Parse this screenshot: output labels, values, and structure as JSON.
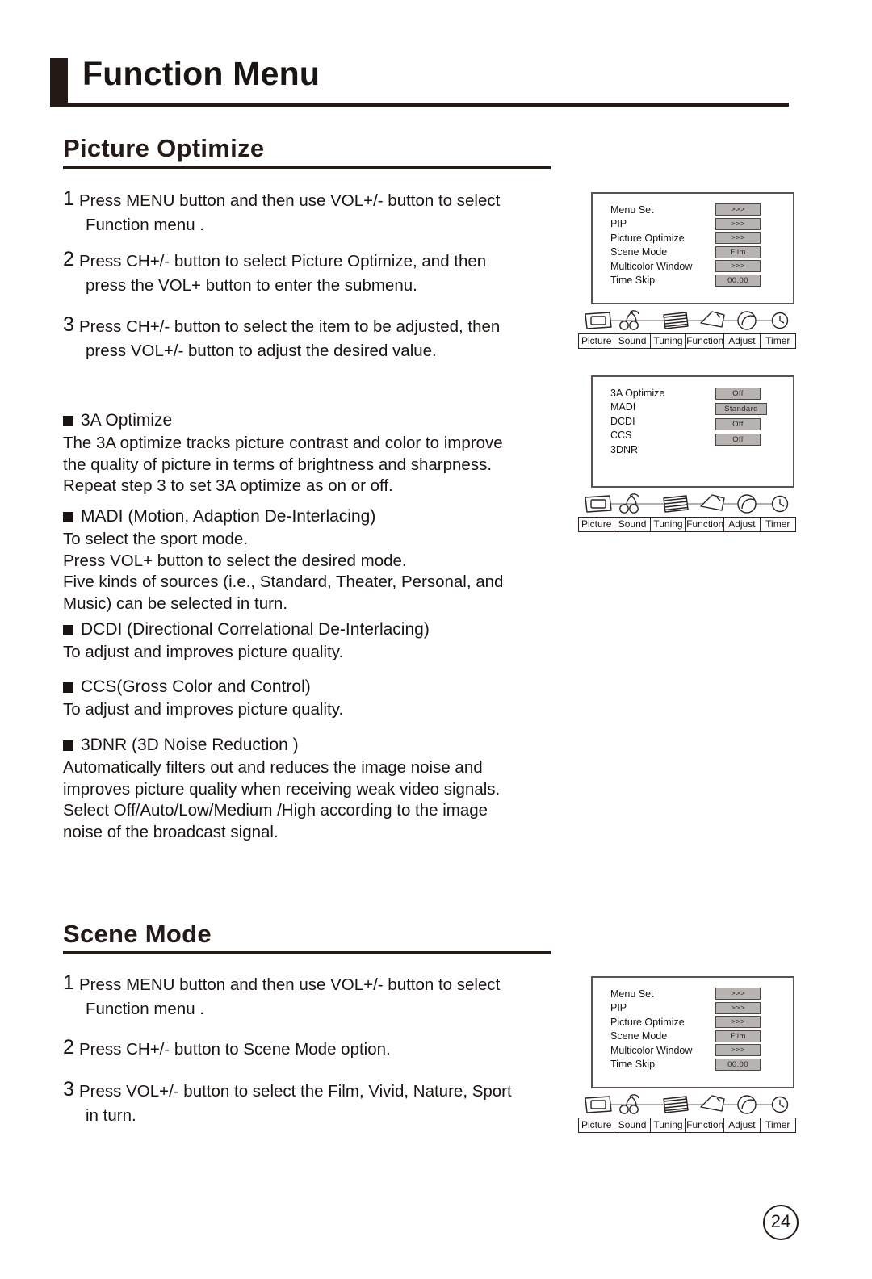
{
  "header": {
    "title": "Function Menu"
  },
  "sections": [
    {
      "heading": "Picture Optimize",
      "steps": [
        {
          "num": "1",
          "lines": [
            "Press MENU button and then use VOL+/- button to select",
            "Function  menu ."
          ]
        },
        {
          "num": "2",
          "lines": [
            "Press CH+/- button to select Picture Optimize, and then",
            "press the VOL+ button to enter the submenu."
          ]
        },
        {
          "num": "3",
          "lines": [
            "Press CH+/- button to select the item to be adjusted, then",
            "press VOL+/- button to adjust the desired value."
          ]
        }
      ]
    },
    {
      "heading": "Scene Mode",
      "steps": [
        {
          "num": "1",
          "lines": [
            "Press MENU button and then use VOL+/- button to select",
            "Function  menu ."
          ]
        },
        {
          "num": "2",
          "lines": [
            "Press CH+/- button to  Scene Mode option."
          ]
        },
        {
          "num": "3",
          "lines": [
            "Press VOL+/- button to select the Film, Vivid, Nature, Sport",
            "in turn."
          ]
        }
      ]
    }
  ],
  "feature_blocks": [
    {
      "title": "3A Optimize",
      "lines": [
        "The 3A optimize tracks picture contrast and color to improve",
        "the quality of picture in terms of brightness and sharpness.",
        "Repeat step 3 to set  3A optimize  as on or off."
      ]
    },
    {
      "title": "MADI (Motion, Adaption De-Interlacing)",
      "lines": [
        "To select the sport mode.",
        "Press VOL+ button to select the desired mode.",
        "Five kinds of sources (i.e., Standard, Theater, Personal, and",
        "Music) can be selected in turn."
      ]
    },
    {
      "title": "DCDI (Directional Correlational De-Interlacing)",
      "lines": [
        "To adjust and improves picture quality."
      ]
    },
    {
      "title": "CCS(Gross Color and  Control)",
      "lines": [
        "To adjust and improves picture quality."
      ]
    },
    {
      "title": "3DNR (3D Noise Reduction )",
      "lines": [
        "Automatically filters out and reduces the image noise and",
        "improves picture quality when receiving weak video signals.",
        "Select Off/Auto/Low/Medium /High   according to the image",
        "noise of the broadcast signal."
      ]
    }
  ],
  "osd_tabs": [
    {
      "label": "Picture",
      "icon": "tv-screen-icon"
    },
    {
      "label": "Sound",
      "icon": "music-notes-icon"
    },
    {
      "label": "Tuning",
      "icon": "stacked-disks-icon"
    },
    {
      "label": "Function",
      "icon": "tag-diamond-icon"
    },
    {
      "label": "Adjust",
      "icon": "circle-swirl-icon"
    },
    {
      "label": "Timer",
      "icon": "clock-icon"
    }
  ],
  "osd_panels": {
    "function_menu": {
      "rows": [
        {
          "label": "Menu Set",
          "value": ">>>"
        },
        {
          "label": "PIP",
          "value": ">>>"
        },
        {
          "label": "Picture Optimize",
          "value": ">>>"
        },
        {
          "label": "Scene Mode",
          "value": "Film"
        },
        {
          "label": "Multicolor Window",
          "value": ">>>"
        },
        {
          "label": "Time Skip",
          "value": "00:00"
        }
      ]
    },
    "picture_optimize_menu": {
      "rows": [
        {
          "label": "3A Optimize"
        },
        {
          "label": "MADI"
        },
        {
          "label": "DCDI"
        },
        {
          "label": "CCS"
        },
        {
          "label": "3DNR"
        }
      ],
      "values": [
        "Off",
        "Standard",
        "Off",
        "Off"
      ]
    }
  },
  "page_number": "24"
}
